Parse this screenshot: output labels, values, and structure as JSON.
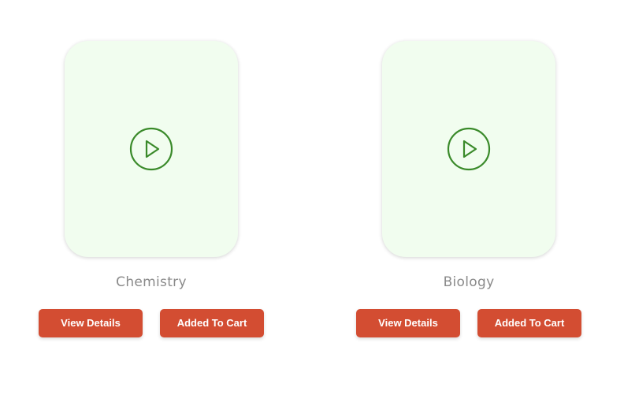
{
  "colors": {
    "thumbnail_bg": "#f1fdef",
    "play_icon": "#3a8a2a",
    "button_bg": "#d34d32",
    "button_text": "#ffffff",
    "title_text": "#8a8a8a"
  },
  "courses": [
    {
      "title": "Chemistry",
      "thumbnail_icon": "play-circle-icon",
      "view_details_label": "View Details",
      "cart_label": "Added To Cart"
    },
    {
      "title": "Biology",
      "thumbnail_icon": "play-circle-icon",
      "view_details_label": "View Details",
      "cart_label": "Added To Cart"
    }
  ]
}
